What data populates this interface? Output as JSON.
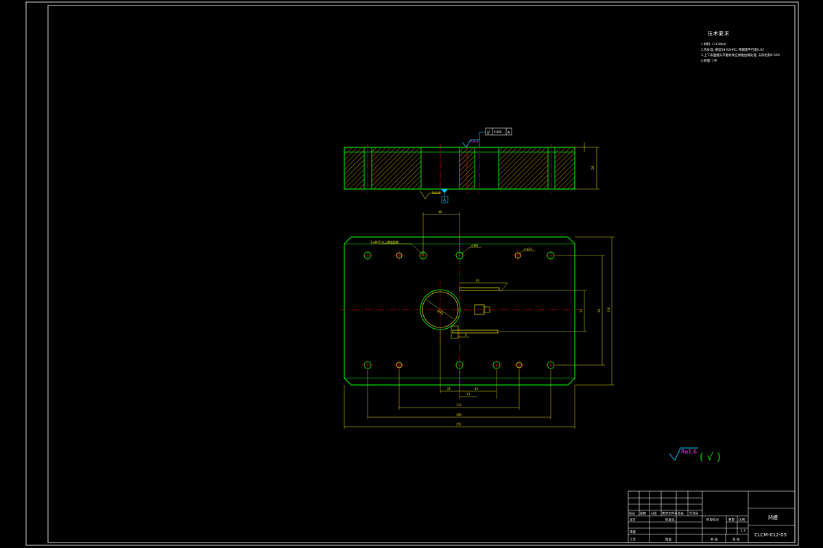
{
  "technical_requirements": {
    "title": "技术要求",
    "lines": [
      "1.材料: Cr12MoV.",
      "2.热处理, 硬度58-62HRC, 两端面平行度0.02",
      "3.上下表面磨光平磨标件应修磨边缘处理, 去除毛刺0.5R0",
      "4.数量: 1件"
    ]
  },
  "section_view": {
    "roughness_top": "Ra0.8",
    "roughness_bottom": "Ra0.8",
    "parallelism_value": "0.005",
    "datum": "A",
    "thickness_dim": "16"
  },
  "plan_view": {
    "hole_label_1": "2-φ8H7(与上模座配做)",
    "hole_label_2": "4-M8",
    "hole_label_3": "4-φ14",
    "dim_top": "48",
    "dim_slot": "62",
    "dim_right_1": "54",
    "dim_right_2": "94",
    "dim_right_3": "130",
    "dim_circle": "φ45",
    "dim_bottom_1": "21",
    "dim_bottom_2": "23",
    "dim_bottom_3": "44",
    "dim_bottom_4": "172",
    "dim_bottom_5": "196",
    "dim_bottom_6": "250",
    "dim_small": "2"
  },
  "surface_symbol": {
    "roughness": "Ra1.6",
    "rest": "( √ )"
  },
  "title_block": {
    "part_name": "凹模",
    "drawing_no": "CLCM-012-05",
    "scale": "1:1",
    "headers": [
      "标记",
      "处数",
      "分区",
      "更改文件号",
      "签名",
      "年月日"
    ],
    "rows": [
      "设计",
      "审核",
      "工艺"
    ],
    "std_label": "标准化",
    "approve_label": "批准",
    "stage_label": "阶段标记",
    "weight_label": "重量",
    "scale_label": "比例",
    "sheets_label": "共 张",
    "sheet_label": "第 张"
  }
}
